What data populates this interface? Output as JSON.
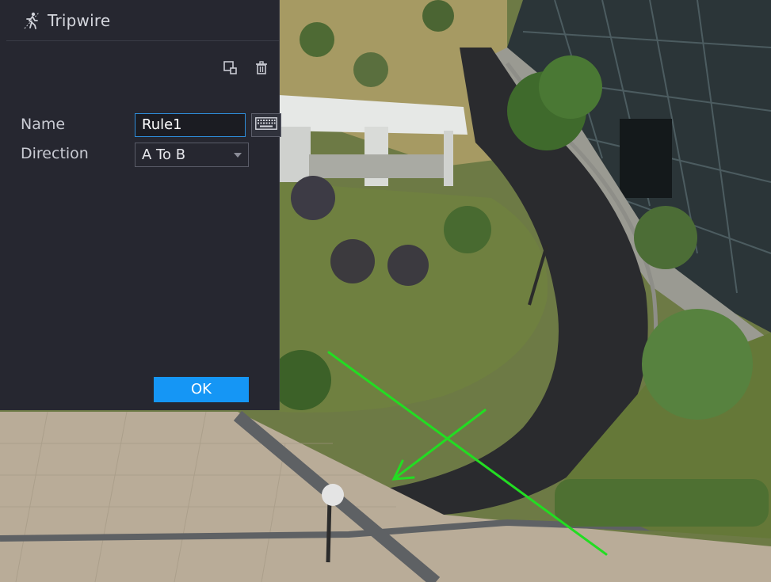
{
  "panel": {
    "title": "Tripwire",
    "title_icon": "running-person-icon",
    "toolbar": {
      "draw_icon": "draw-region-icon",
      "delete_icon": "trash-icon"
    },
    "fields": {
      "name_label": "Name",
      "name_value": "Rule1",
      "keyboard_icon": "keyboard-icon",
      "direction_label": "Direction",
      "direction_value": "A To B"
    },
    "ok_label": "OK"
  },
  "overlay": {
    "tripwire_color": "#22dd22"
  },
  "colors": {
    "panel_bg": "#262730",
    "accent": "#1596f5",
    "input_border": "#2e8cd8"
  }
}
